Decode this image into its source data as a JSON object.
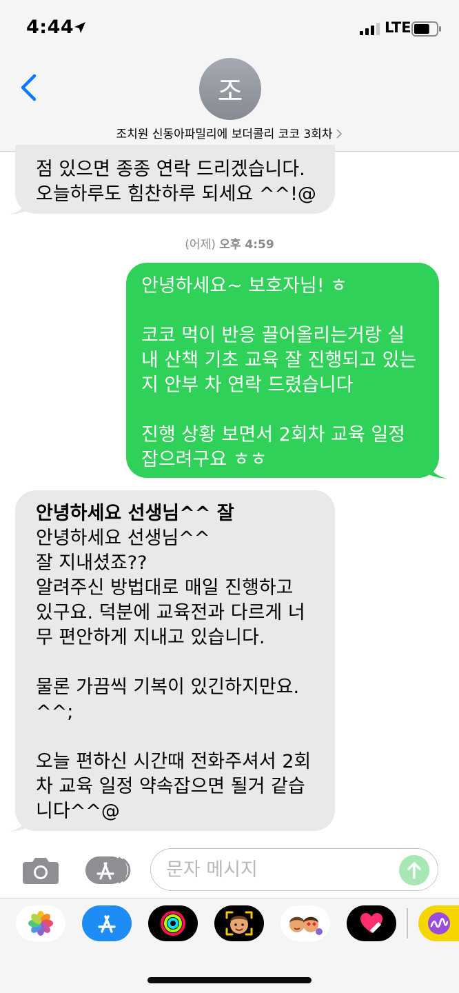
{
  "status_bar": {
    "time": "4:44",
    "network": "LTE",
    "signal_bars": 4,
    "signal_bars_active": 3,
    "battery_level": 0.7
  },
  "header": {
    "avatar_initial": "조",
    "contact_name": "조치원 신동아파밀리에 보더콜리 코코 3회차"
  },
  "messages": {
    "first": {
      "direction": "incoming",
      "lines": [
        "점 있으면 종종 연락 드리겠습니다.",
        "오늘하루도 힘찬하루 되세요 ^^!@"
      ]
    },
    "timestamp": {
      "day": "(어제)",
      "time": "오후 4:59"
    },
    "second": {
      "direction": "outgoing",
      "lines": [
        "안녕하세요~ 보호자님! ㅎ",
        "",
        "코코 먹이 반응 끌어올리는거랑 실",
        "내 산책 기초 교육 잘 진행되고 있는",
        "지 안부 차 연락 드렸습니다",
        "",
        "진행 상황 보면서 2회차 교육 일정",
        "잡으려구요 ㅎㅎ"
      ]
    },
    "third": {
      "direction": "incoming",
      "preview": "안녕하세요 선생님^^ 잘",
      "lines": [
        "안녕하세요 선생님^^",
        "잘 지내셨죠??",
        "알려주신 방법대로 매일 진행하고",
        "있구요. 덕분에 교육전과 다르게 너",
        "무 편안하게 지내고 있습니다.",
        "",
        "물론 가끔씩 기복이 있긴하지만요.",
        "^^;",
        "",
        "오늘 편하신 시간때 전화주셔서 2회",
        "차 교육 일정 약속잡으면 될거 같습",
        "니다^^@"
      ]
    }
  },
  "composer": {
    "placeholder": "문자 메시지"
  },
  "app_drawer": {
    "apps": [
      "photos-icon",
      "app-store-icon",
      "activity-icon",
      "memoji-icon",
      "animoji-stickers-icon",
      "digital-touch-icon",
      "music-app-icon"
    ]
  },
  "colors": {
    "outgoing_bubble": "#30d158",
    "incoming_bubble": "#e9e9eb",
    "accent": "#0a7aff",
    "send_button_disabled": "#a6e7b4"
  }
}
